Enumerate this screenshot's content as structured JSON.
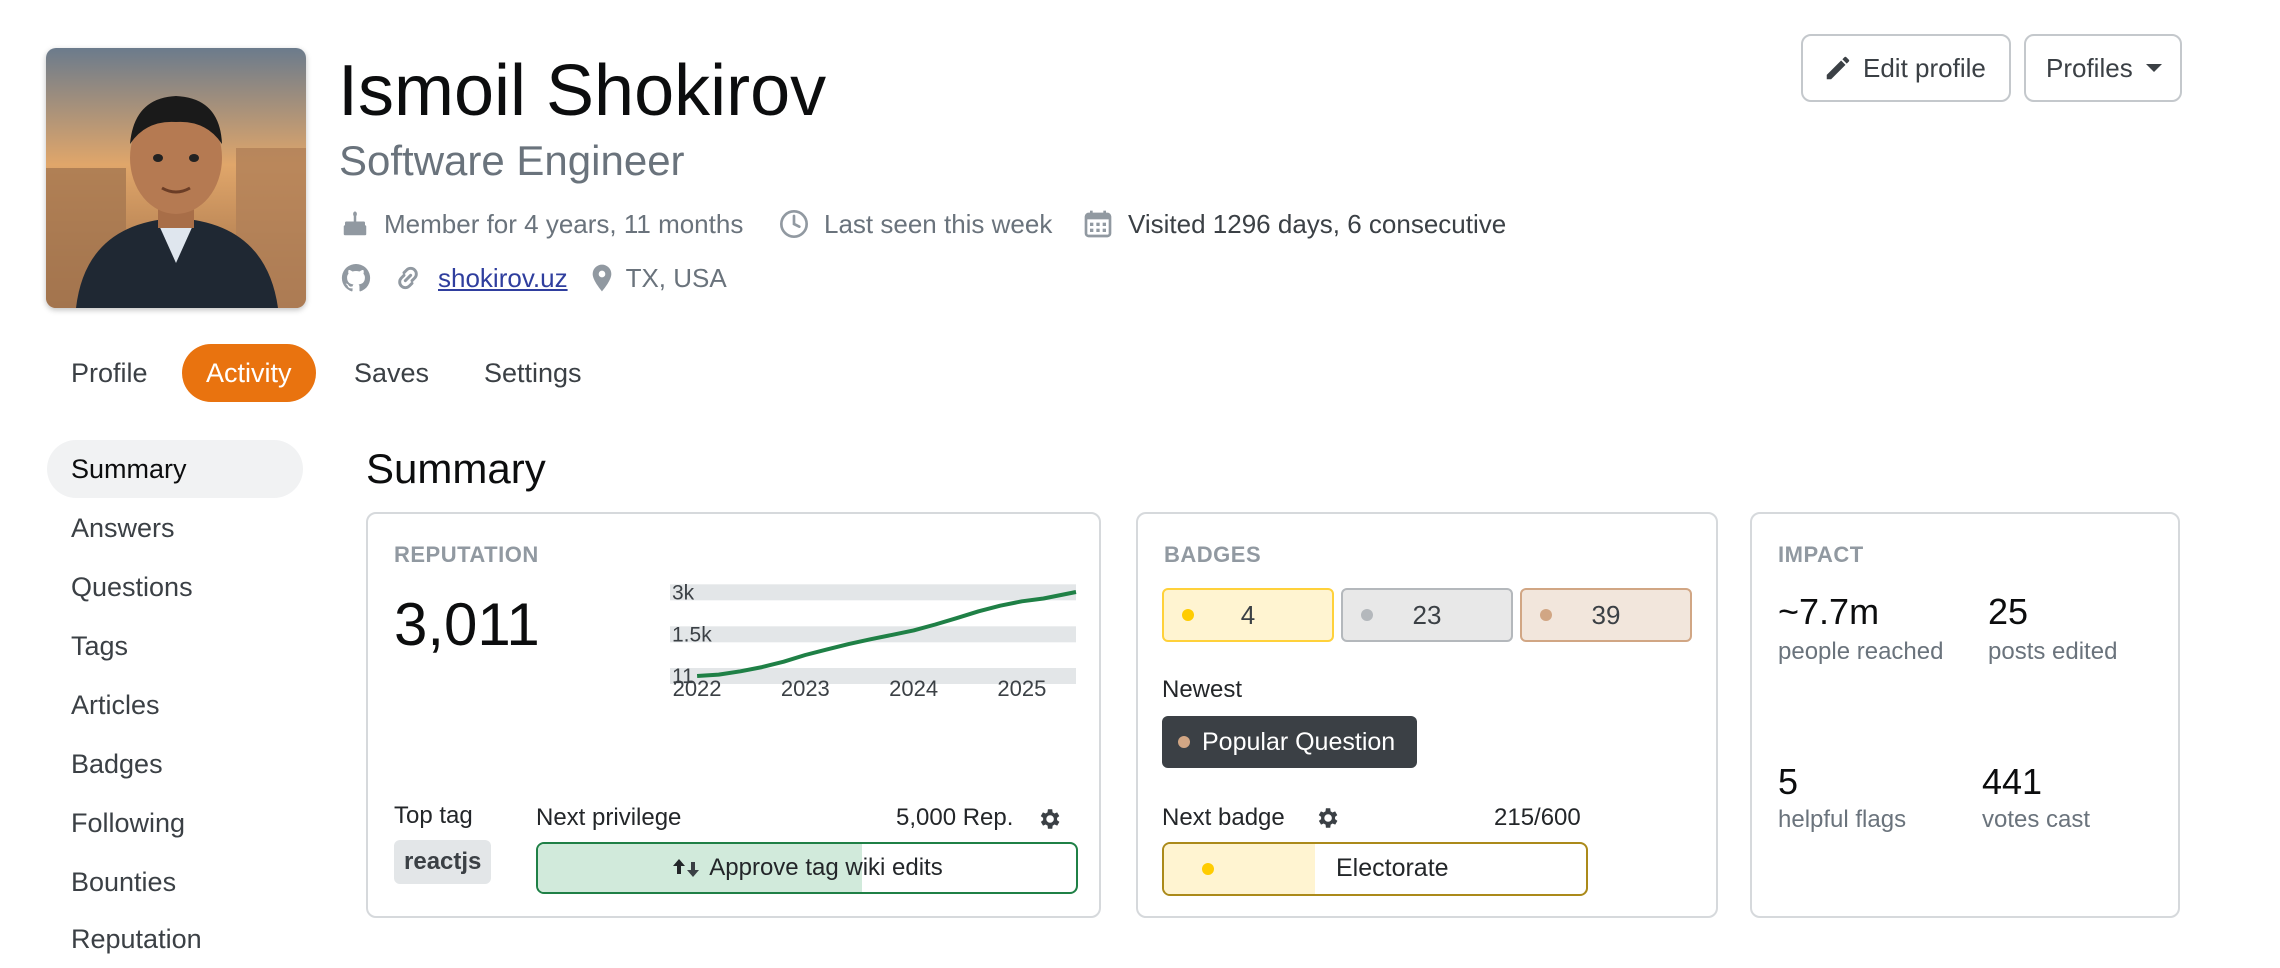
{
  "profile": {
    "name": "Ismoil Shokirov",
    "title": "Software Engineer",
    "member_for": "Member for 4 years, 11 months",
    "last_seen": "Last seen this week",
    "visited": "Visited 1296 days, 6 consecutive",
    "website": "shokirov.uz",
    "location": "TX, USA"
  },
  "header_buttons": {
    "edit_profile": "Edit profile",
    "profiles": "Profiles"
  },
  "tabs": [
    {
      "label": "Profile",
      "active": false
    },
    {
      "label": "Activity",
      "active": true
    },
    {
      "label": "Saves",
      "active": false
    },
    {
      "label": "Settings",
      "active": false
    }
  ],
  "sidenav": [
    {
      "label": "Summary",
      "active": true
    },
    {
      "label": "Answers"
    },
    {
      "label": "Questions"
    },
    {
      "label": "Tags"
    },
    {
      "label": "Articles"
    },
    {
      "label": "Badges"
    },
    {
      "label": "Following"
    },
    {
      "label": "Bounties"
    },
    {
      "label": "Reputation"
    }
  ],
  "summary_title": "Summary",
  "reputation": {
    "label": "REPUTATION",
    "value": "3,011",
    "top_tag_label": "Top tag",
    "top_tag": "reactjs",
    "next_privilege_label": "Next privilege",
    "next_privilege_rep": "5,000 Rep.",
    "next_privilege_name": "Approve tag wiki edits",
    "next_privilege_progress": 0.602
  },
  "badges": {
    "label": "BADGES",
    "gold": "4",
    "silver": "23",
    "bronze": "39",
    "newest_label": "Newest",
    "newest_badge": "Popular Question",
    "next_badge_label": "Next badge",
    "next_badge_progress_text": "215/600",
    "next_badge_name": "Electorate",
    "next_badge_progress": 0.358
  },
  "impact": {
    "label": "IMPACT",
    "items": [
      {
        "value": "~7.7m",
        "label": "people reached"
      },
      {
        "value": "25",
        "label": "posts edited"
      },
      {
        "value": "5",
        "label": "helpful flags"
      },
      {
        "value": "441",
        "label": "votes cast"
      }
    ]
  },
  "colors": {
    "accent": "#e9730f",
    "link": "#2f3e9e",
    "chart_line": "#1f8046",
    "gold": "#ffcc01",
    "silver": "#b4b8bc",
    "bronze": "#d1a684"
  },
  "chart_data": {
    "type": "line",
    "title": "",
    "y_ticks": [
      "3k",
      "1.5k",
      "11"
    ],
    "y_tick_values": [
      3000,
      1500,
      11
    ],
    "x_ticks": [
      "2022",
      "2023",
      "2024",
      "2025"
    ],
    "x_tick_values": [
      2022,
      2023,
      2024,
      2025
    ],
    "xlim": [
      2021.75,
      2025.5
    ],
    "ylim": [
      11,
      3011
    ],
    "series": [
      {
        "x": [
          2022.0,
          2022.2,
          2022.4,
          2022.6,
          2022.8,
          2023.0,
          2023.2,
          2023.4,
          2023.6,
          2023.8,
          2024.0,
          2024.2,
          2024.4,
          2024.6,
          2024.8,
          2025.0,
          2025.2,
          2025.5
        ],
        "y": [
          11,
          60,
          180,
          330,
          520,
          760,
          960,
          1150,
          1320,
          1480,
          1640,
          1850,
          2080,
          2320,
          2520,
          2680,
          2780,
          3011
        ]
      }
    ]
  }
}
